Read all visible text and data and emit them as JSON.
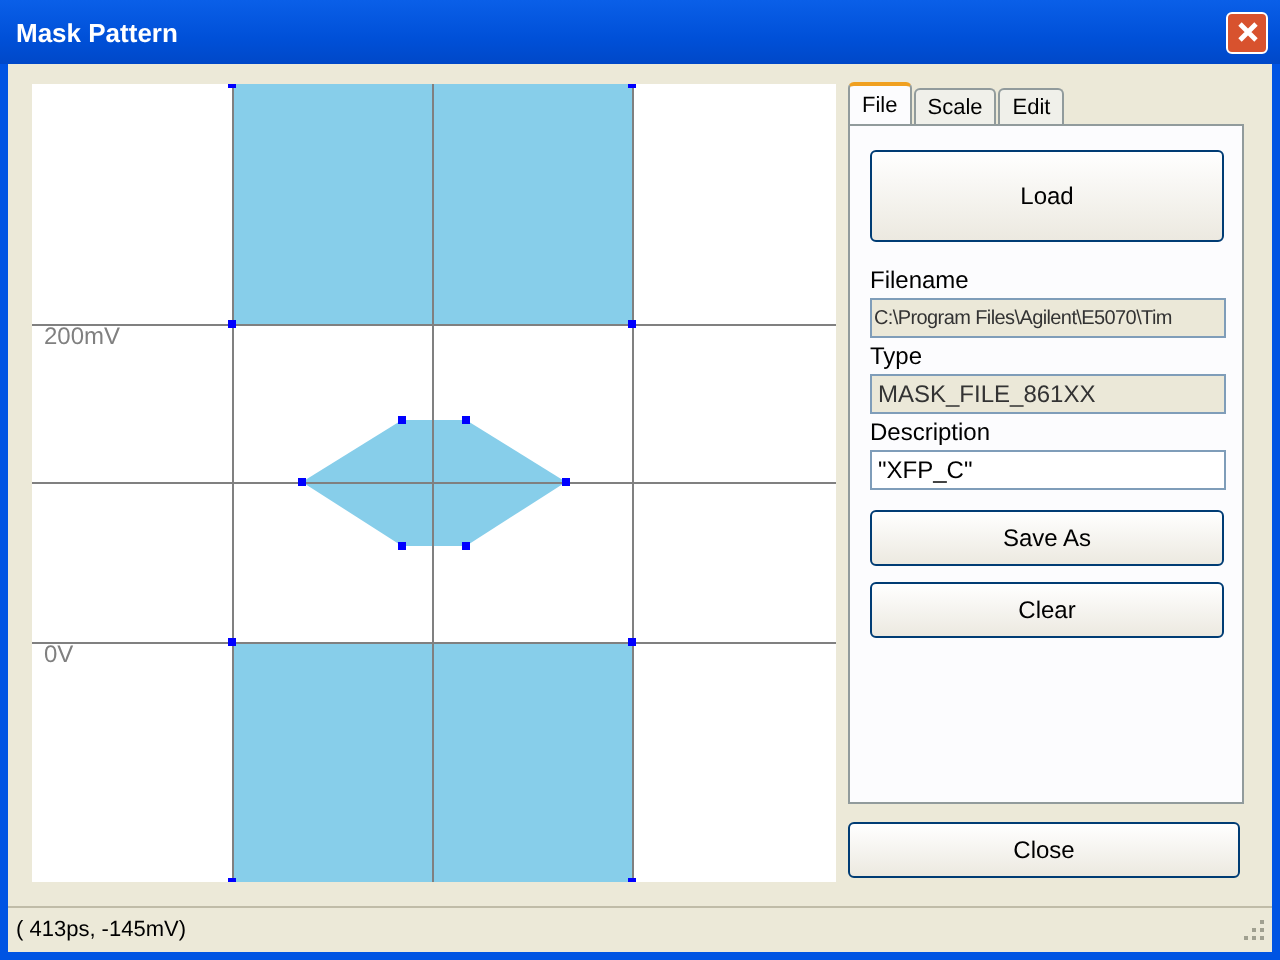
{
  "window": {
    "title": "Mask Pattern"
  },
  "plot": {
    "labels": [
      {
        "text": "200mV"
      },
      {
        "text": "0V"
      }
    ]
  },
  "tabs": [
    {
      "label": "File",
      "selected": true
    },
    {
      "label": "Scale",
      "selected": false
    },
    {
      "label": "Edit",
      "selected": false
    }
  ],
  "file_panel": {
    "load_button": "Load",
    "fields": [
      {
        "label": "Filename",
        "value": "C:\\Program Files\\Agilent\\E5070\\Tim",
        "readonly": true
      },
      {
        "label": "Type",
        "value": "MASK_FILE_861XX",
        "readonly": true
      },
      {
        "label": "Description",
        "value": "\"XFP_C\"",
        "readonly": false
      }
    ],
    "buttons": [
      "Save As",
      "Clear"
    ]
  },
  "close_button": "Close",
  "status_bar": "( 413ps, -145mV)"
}
